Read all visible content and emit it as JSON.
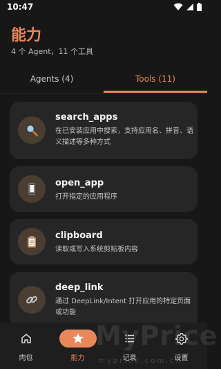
{
  "status_bar": {
    "time": "10:47",
    "icons": [
      "wifi-icon",
      "signal-icon",
      "battery-icon"
    ]
  },
  "header": {
    "title": "能力",
    "subtitle": "4 个 Agent，11 个工具"
  },
  "tabs": [
    {
      "label": "Agents (4)",
      "selected": false
    },
    {
      "label": "Tools (11)",
      "selected": true
    }
  ],
  "tools": [
    {
      "icon": "magnifier-icon",
      "name": "search_apps",
      "description": "在已安装应用中搜索，支持应用名、拼音、语义描述等多种方式"
    },
    {
      "icon": "phone-icon",
      "name": "open_app",
      "description": "打开指定的应用程序"
    },
    {
      "icon": "clipboard-icon",
      "name": "clipboard",
      "description": "读取或写入系统剪贴板内容"
    },
    {
      "icon": "link-icon",
      "name": "deep_link",
      "description": "通过 DeepLink/Intent 打开应用的特定页面或功能"
    }
  ],
  "bottom_nav": [
    {
      "icon": "home-icon",
      "label": "肉包",
      "selected": false
    },
    {
      "icon": "star-icon",
      "label": "能力",
      "selected": true
    },
    {
      "icon": "list-icon",
      "label": "记录",
      "selected": false
    },
    {
      "icon": "gear-icon",
      "label": "设置",
      "selected": false
    }
  ],
  "watermark": {
    "text": "MyPrice",
    "url": "myprice.com.cn"
  },
  "colors": {
    "accent": "#e8875a",
    "background": "#171717",
    "card": "#262626",
    "icon_circle": "#4a3d32"
  }
}
